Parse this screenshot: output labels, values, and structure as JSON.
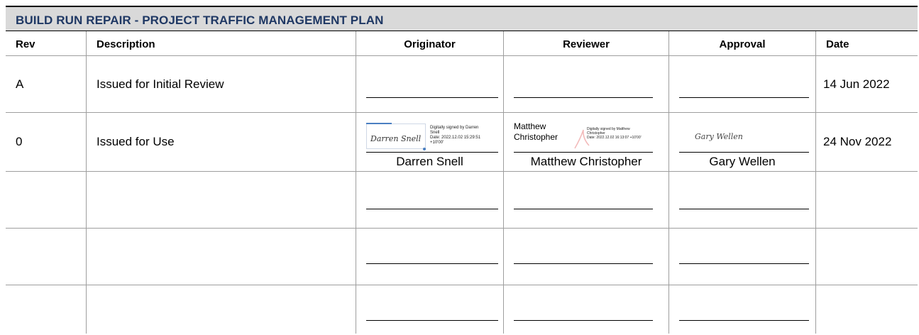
{
  "title": "BUILD RUN REPAIR - PROJECT TRAFFIC MANAGEMENT PLAN",
  "headers": {
    "rev": "Rev",
    "description": "Description",
    "originator": "Originator",
    "reviewer": "Reviewer",
    "approval": "Approval",
    "date": "Date"
  },
  "rows": [
    {
      "rev": "A",
      "description": "Issued for Initial Review",
      "date": "14 Jun 2022"
    },
    {
      "rev": "0",
      "description": "Issued for Use",
      "date": "24 Nov 2022",
      "originator": {
        "signature": "Darren Snell",
        "signed_line1": "Digitally signed by Darren",
        "signed_line2": "Snell",
        "signed_line3": "Date: 2022.12.02 15:29:51",
        "signed_line4": "+10'00'",
        "name": "Darren Snell"
      },
      "reviewer": {
        "sig_line1": "Matthew",
        "sig_line2": "Christopher",
        "signed_line1": "Digitally signed by Matthew",
        "signed_line2": "Christopher",
        "signed_line3": "Date: 2022.12.02 16:13:07 +10'00'",
        "name": "Matthew Christopher"
      },
      "approval": {
        "signature": "Gary Wellen",
        "name": "Gary Wellen"
      }
    },
    {
      "rev": "",
      "description": "",
      "date": ""
    },
    {
      "rev": "",
      "description": "",
      "date": ""
    },
    {
      "rev": "",
      "description": "",
      "date": ""
    }
  ],
  "colors": {
    "title_text": "#1f3864",
    "title_bg": "#d9d9d9",
    "grid": "#9e9e9e"
  }
}
